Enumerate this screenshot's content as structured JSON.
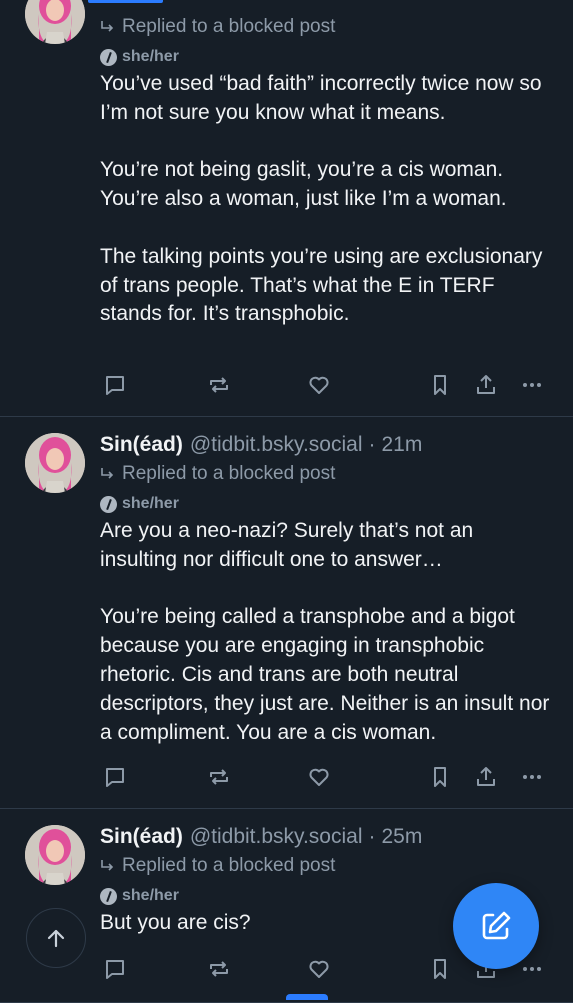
{
  "posts": [
    {
      "author": "",
      "handle": "",
      "time": "",
      "reply_text": "Replied to a blocked post",
      "pronouns": "she/her",
      "paragraphs": [
        "You’ve used “bad faith” incorrectly twice now so I’m not sure you know what it means.",
        "You’re not being gaslit, you’re a cis woman. You’re also a woman, just like I’m a woman.",
        "The talking points you’re using are exclusionary of trans people. That’s what the E in TERF stands for. It’s transphobic."
      ]
    },
    {
      "author": "Sin(éad)",
      "handle": "@tidbit.bsky.social",
      "time": "21m",
      "reply_text": "Replied to a blocked post",
      "pronouns": "she/her",
      "paragraphs": [
        "Are you a neo-nazi? Surely that’s not an insulting nor difficult one to answer…",
        "You’re being called a transphobe and a bigot because you are engaging in transphobic rhetoric. Cis and trans are both neutral descriptors, they just are. Neither is an insult nor a compliment. You are a cis woman."
      ]
    },
    {
      "author": "Sin(éad)",
      "handle": "@tidbit.bsky.social",
      "time": "25m",
      "reply_text": "Replied to a blocked post",
      "pronouns": "she/her",
      "paragraphs": [
        "But you are cis?"
      ]
    }
  ],
  "icons": {
    "reply": "speech-bubble-icon",
    "repost": "repost-arrows-icon",
    "like": "heart-icon",
    "save": "bookmark-icon",
    "share": "share-upload-icon",
    "more": "ellipsis-icon",
    "scroll_top": "arrow-up-icon",
    "compose": "compose-pencil-icon"
  },
  "colors": {
    "background": "#161e27",
    "text": "#f1f3f5",
    "muted": "#8d9aa8",
    "accent": "#2f86f6"
  }
}
